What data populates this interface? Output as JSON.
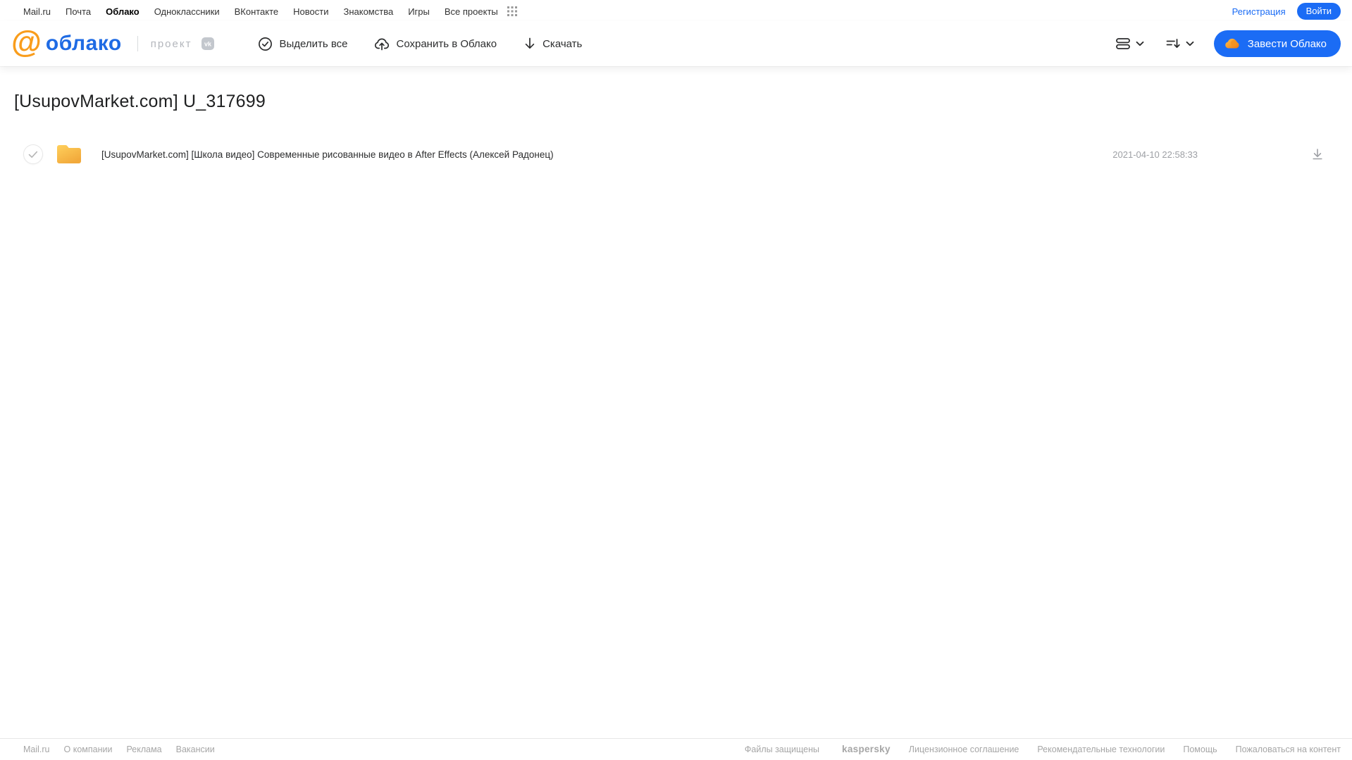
{
  "topbar": {
    "links": [
      {
        "label": "Mail.ru"
      },
      {
        "label": "Почта"
      },
      {
        "label": "Облако",
        "active": true
      },
      {
        "label": "Одноклассники"
      },
      {
        "label": "ВКонтакте"
      },
      {
        "label": "Новости"
      },
      {
        "label": "Знакомства"
      },
      {
        "label": "Игры"
      },
      {
        "label": "Все проекты"
      }
    ],
    "registration_label": "Регистрация",
    "login_label": "Войти"
  },
  "header": {
    "logo_at": "@",
    "logo_text": "облако",
    "project_label": "проект",
    "vk_badge": "vk",
    "toolbar": {
      "select_all_label": "Выделить все",
      "save_to_cloud_label": "Сохранить в Облако",
      "download_label": "Скачать"
    },
    "create_cloud_label": "Завести Облако"
  },
  "main": {
    "title": "[UsupovMarket.com] U_317699",
    "files": [
      {
        "type": "folder",
        "name": "[UsupovMarket.com] [Школа видео] Современные рисованные видео в After Effects (Алексей Радонец)",
        "date": "2021-04-10 22:58:33"
      }
    ]
  },
  "footer": {
    "left_links": [
      {
        "label": "Mail.ru"
      },
      {
        "label": "О компании"
      },
      {
        "label": "Реклама"
      },
      {
        "label": "Вакансии"
      }
    ],
    "protected_text": "Файлы защищены",
    "kaspersky_label": "kaspersky",
    "right_links": [
      {
        "label": "Лицензионное соглашение"
      },
      {
        "label": "Рекомендательные технологии"
      },
      {
        "label": "Помощь"
      },
      {
        "label": "Пожаловаться на контент"
      }
    ]
  },
  "icons": {
    "grid": "apps-grid-icon",
    "check_circle": "select-all check in circle",
    "cloud_upload": "cloud with up arrow",
    "arrow_down": "download arrow",
    "list_view": "stacked rows view toggle",
    "sort": "sort lines with down arrow",
    "chevron_down": "dropdown chevron",
    "cloud": "orange cloud brand mark",
    "folder": "yellow folder",
    "download_tray": "down arrow with underline"
  },
  "colors": {
    "accent_blue": "#1b6cf5",
    "logo_blue": "#1f6be4",
    "logo_orange": "#f99d1c",
    "folder_yellow_top": "#ffd05c",
    "folder_yellow_bottom": "#f2a93b",
    "kaspersky_green": "#1d9f86",
    "muted_grey": "#a6a6a6"
  }
}
